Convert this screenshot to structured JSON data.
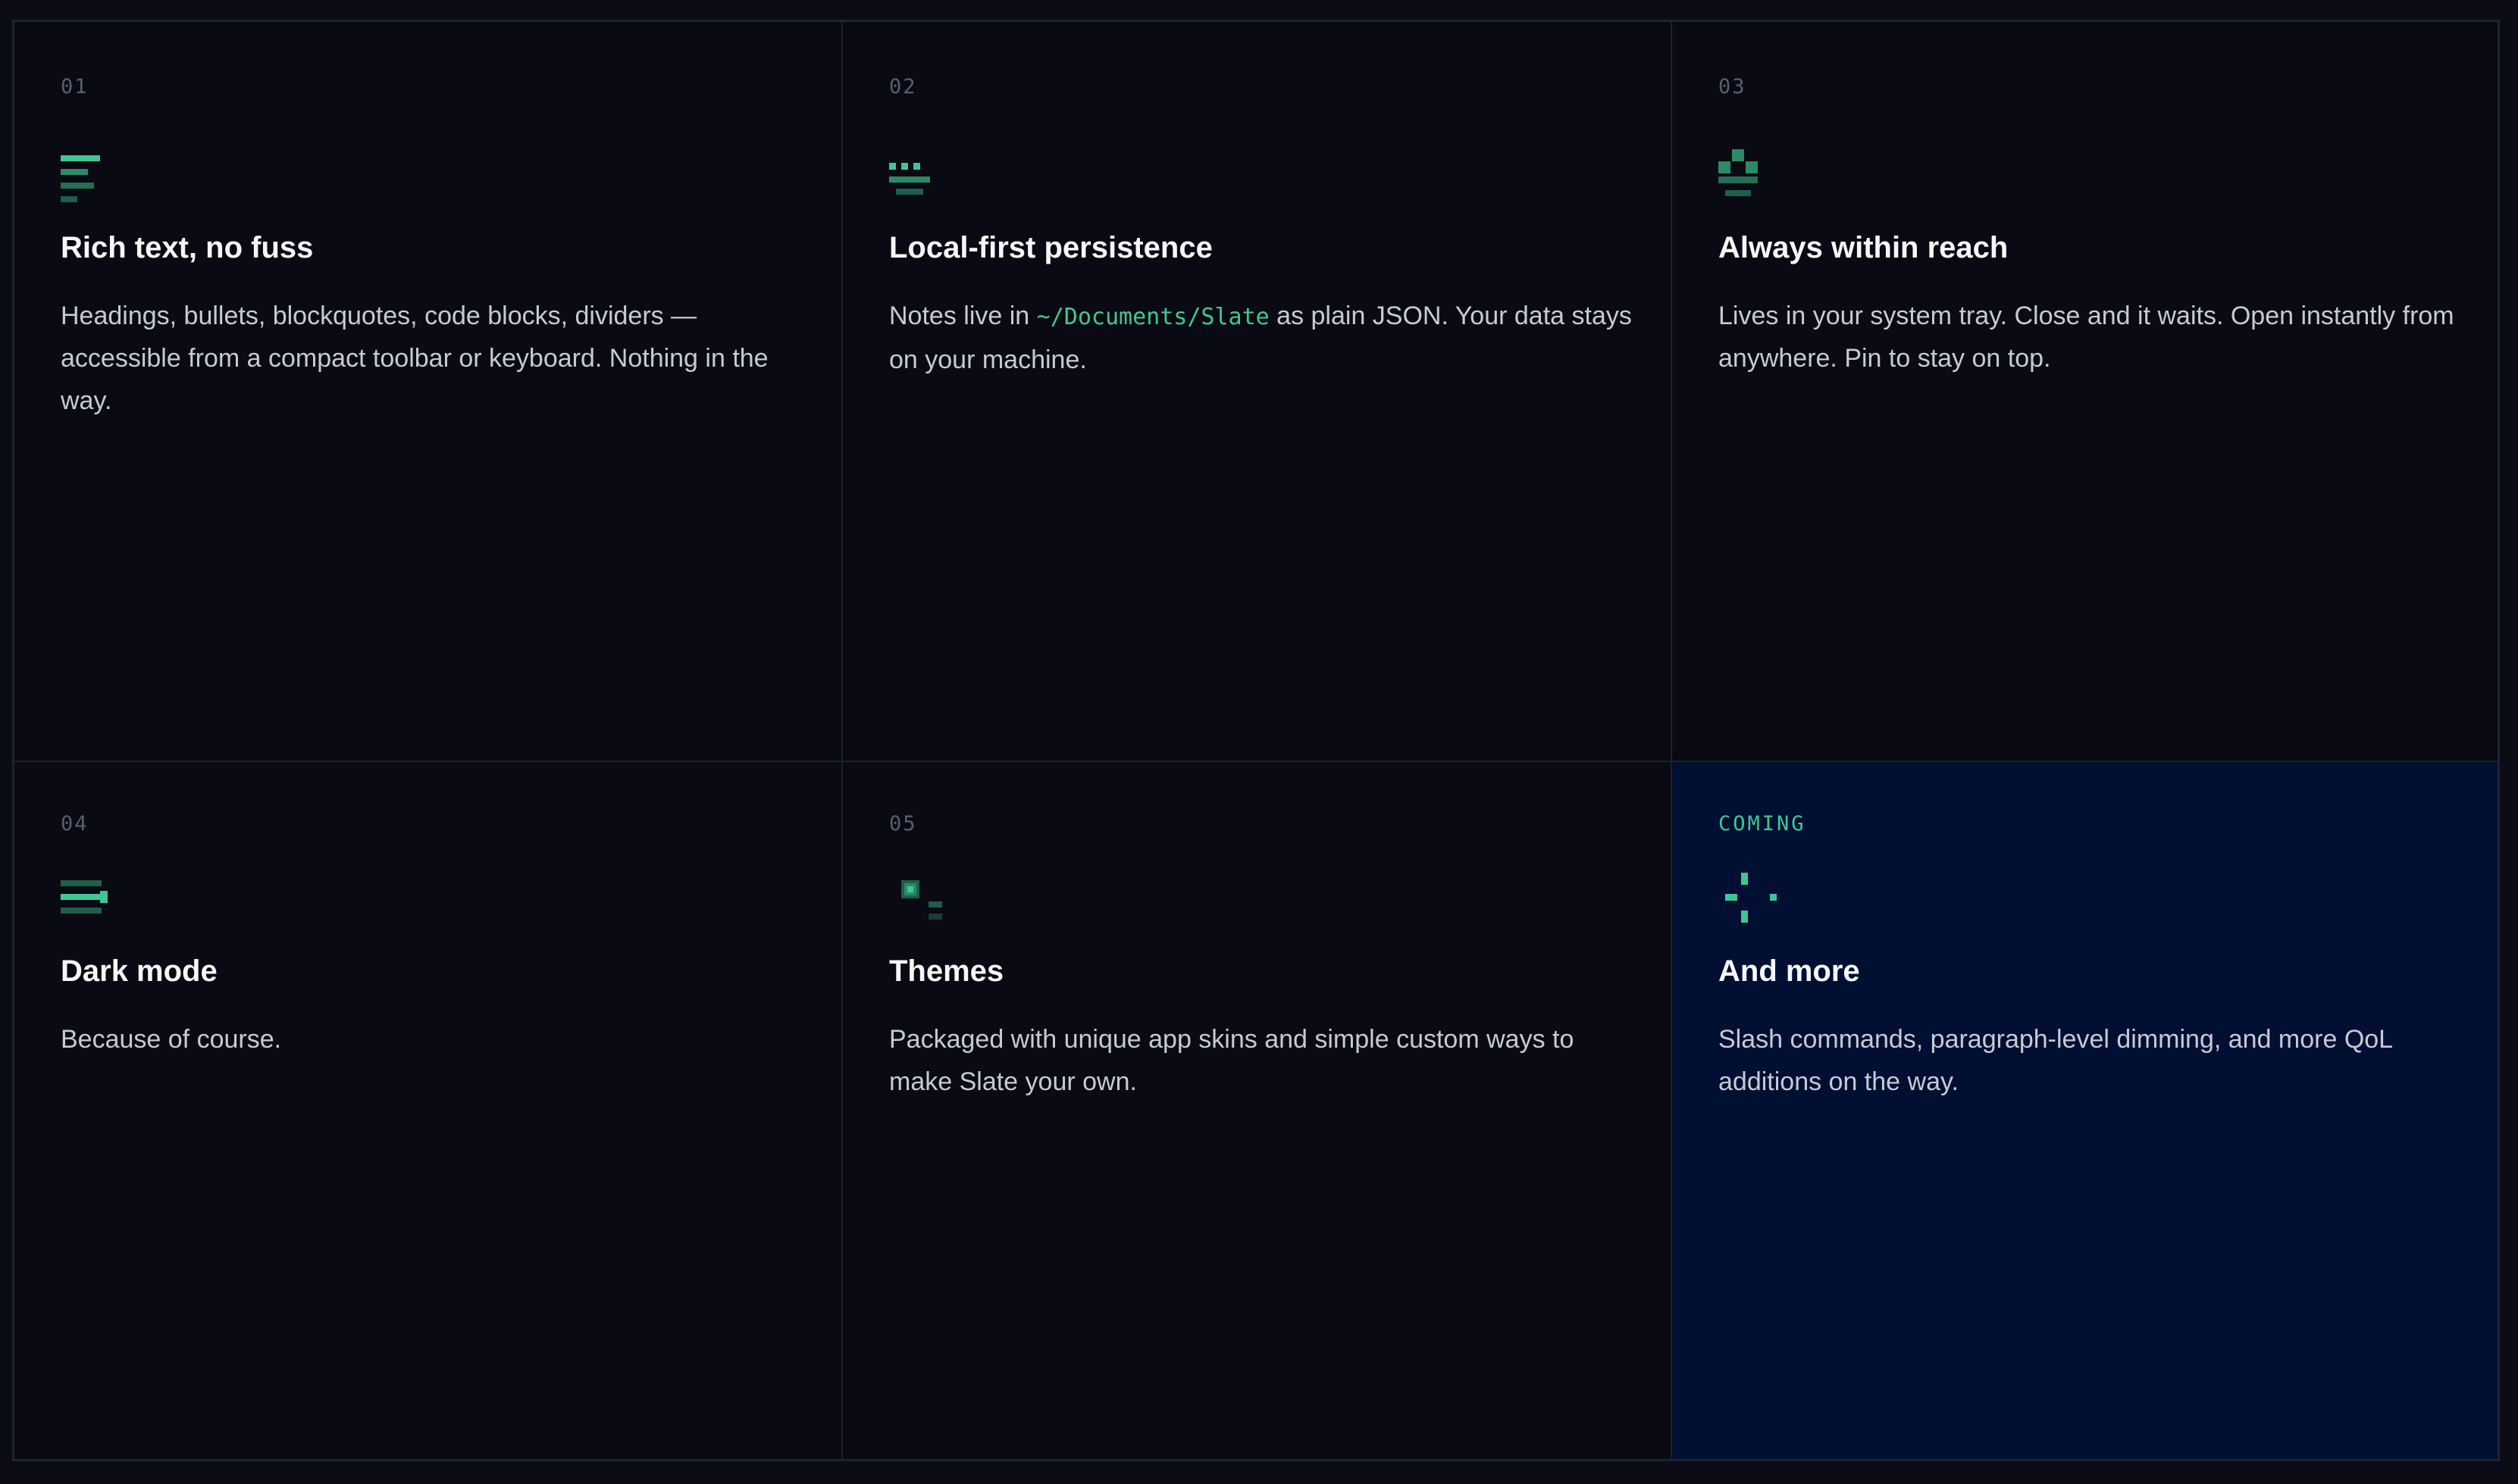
{
  "colors": {
    "background": "#0b0c15",
    "card": "#090a13",
    "card_highlight": "#010f33",
    "accent": "#3fc793",
    "accent_dim": "#1f5e48",
    "border": "#1c2030"
  },
  "features": [
    {
      "number": "01",
      "icon": "rich-text-icon",
      "title": "Rich text, no fuss",
      "description": "Headings, bullets, blockquotes, code blocks, dividers — accessible from a compact toolbar or keyboard. Nothing in the way."
    },
    {
      "number": "02",
      "icon": "persistence-icon",
      "title": "Local-first persistence",
      "description_before": "Notes live in",
      "path": "~/Documents/Slate",
      "description_after": "as plain JSON. Your data stays on your machine."
    },
    {
      "number": "03",
      "icon": "tray-icon",
      "title": "Always within reach",
      "description": "Lives in your system tray. Close and it waits. Open instantly from anywhere. Pin to stay on top."
    },
    {
      "number": "04",
      "icon": "dark-mode-toggle-icon",
      "title": "Dark mode",
      "description": "Because of course."
    },
    {
      "number": "05",
      "icon": "themes-icon",
      "title": "Themes",
      "description": "Packaged with unique app skins and simple custom ways to make Slate your own."
    },
    {
      "number": "COMING",
      "icon": "sparkle-icon",
      "title": "And more",
      "description": "Slash commands, paragraph-level dimming, and more QoL additions on the way."
    }
  ]
}
